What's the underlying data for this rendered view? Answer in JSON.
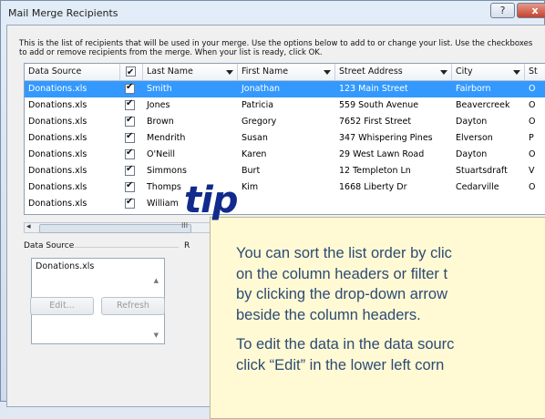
{
  "window": {
    "title": "Mail Merge Recipients",
    "help_label": "?",
    "close_label": "x"
  },
  "intro_text": "This is the list of recipients that will be used in your merge.  Use the options below to add to or change your list.  Use the checkboxes to add or remove recipients from the merge.  When your list is ready, click OK.",
  "table": {
    "headers": [
      "Data Source",
      "",
      "Last Name",
      "First Name",
      "Street Address",
      "City",
      "St"
    ],
    "rows": [
      [
        "Donations.xls",
        "Smith",
        "Jonathan",
        "123 Main Street",
        "Fairborn",
        "O"
      ],
      [
        "Donations.xls",
        "Jones",
        "Patricia",
        "559 South Avenue",
        "Beavercreek",
        "O"
      ],
      [
        "Donations.xls",
        "Brown",
        "Gregory",
        "7652 First Street",
        "Dayton",
        "O"
      ],
      [
        "Donations.xls",
        "Mendrith",
        "Susan",
        "347 Whispering Pines",
        "Elverson",
        "P"
      ],
      [
        "Donations.xls",
        "O'Neill",
        "Karen",
        "29 West Lawn Road",
        "Dayton",
        "O"
      ],
      [
        "Donations.xls",
        "Simmons",
        "Burt",
        "12 Templeton Ln",
        "Stuartsdraft",
        "V"
      ],
      [
        "Donations.xls",
        "Thomps",
        "Kim",
        "1668 Liberty Dr",
        "Cedarville",
        "O"
      ],
      [
        "Donations.xls",
        "William",
        "",
        "",
        "",
        ""
      ]
    ]
  },
  "scrollbar": {
    "left_arrow": "◂",
    "grip": "III"
  },
  "data_source_group": {
    "label": "Data Source",
    "items": [
      "Donations.xls"
    ],
    "edit_label": "Edit...",
    "refresh_label": "Refresh"
  },
  "refine_stub": "R",
  "tip": {
    "word": "tip",
    "paragraphs": [
      "You can sort the list order by clic",
      "on the column headers or filter t",
      "by clicking the drop-down arrow",
      "beside the column headers.",
      "To edit the data in the data sourc",
      "click “Edit” in the lower left corn"
    ]
  }
}
